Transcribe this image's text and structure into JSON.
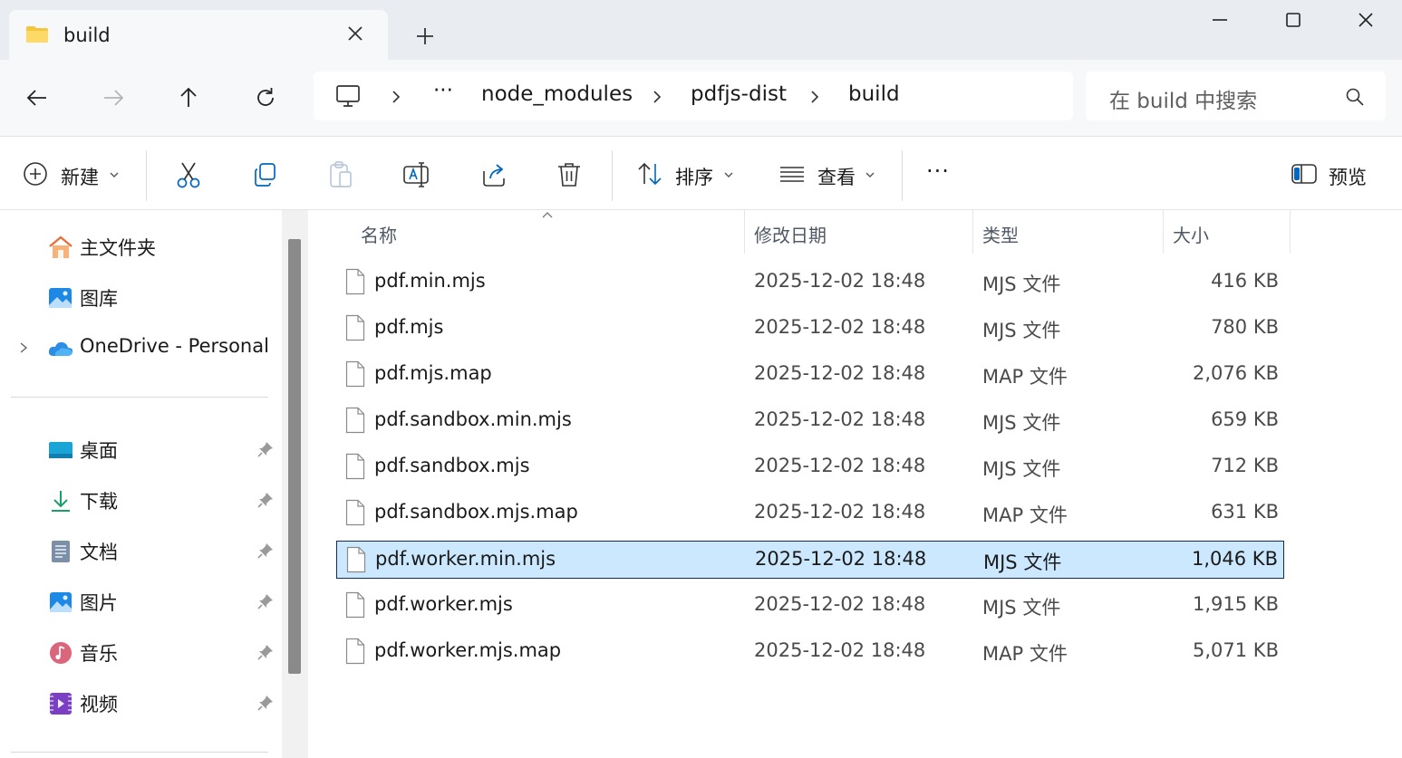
{
  "window": {
    "tab_title": "build",
    "new_tab_icon": "plus-icon",
    "controls": [
      "minimize-icon",
      "maximize-icon",
      "close-icon"
    ]
  },
  "nav": {
    "buttons": [
      "back-arrow-icon",
      "forward-arrow-icon",
      "up-arrow-icon",
      "refresh-icon"
    ],
    "breadcrumb": {
      "overflow": "···",
      "items": [
        "node_modules",
        "pdfjs-dist",
        "build"
      ]
    },
    "search_placeholder": "在 build 中搜索"
  },
  "commands": {
    "new": "新建",
    "sort": "排序",
    "view": "查看",
    "more": "···",
    "preview": "预览"
  },
  "sidebar": {
    "top": [
      {
        "label": "主文件夹",
        "icon": "home-icon"
      },
      {
        "label": "图库",
        "icon": "gallery-icon"
      },
      {
        "label": "OneDrive - Personal",
        "icon": "onedrive-cloud-icon"
      }
    ],
    "pinned": [
      {
        "label": "桌面",
        "icon": "desktop-icon"
      },
      {
        "label": "下载",
        "icon": "download-icon"
      },
      {
        "label": "文档",
        "icon": "documents-icon"
      },
      {
        "label": "图片",
        "icon": "pictures-icon"
      },
      {
        "label": "音乐",
        "icon": "music-icon"
      },
      {
        "label": "视频",
        "icon": "videos-icon"
      }
    ]
  },
  "table": {
    "headers": {
      "name": "名称",
      "date": "修改日期",
      "type": "类型",
      "size": "大小"
    },
    "sort_column": "name",
    "rows": [
      {
        "name": "pdf.min.mjs",
        "date": "2025-12-02 18:48",
        "type": "MJS 文件",
        "size": "416 KB"
      },
      {
        "name": "pdf.mjs",
        "date": "2025-12-02 18:48",
        "type": "MJS 文件",
        "size": "780 KB"
      },
      {
        "name": "pdf.mjs.map",
        "date": "2025-12-02 18:48",
        "type": "MAP 文件",
        "size": "2,076 KB"
      },
      {
        "name": "pdf.sandbox.min.mjs",
        "date": "2025-12-02 18:48",
        "type": "MJS 文件",
        "size": "659 KB"
      },
      {
        "name": "pdf.sandbox.mjs",
        "date": "2025-12-02 18:48",
        "type": "MJS 文件",
        "size": "712 KB"
      },
      {
        "name": "pdf.sandbox.mjs.map",
        "date": "2025-12-02 18:48",
        "type": "MAP 文件",
        "size": "631 KB"
      },
      {
        "name": "pdf.worker.min.mjs",
        "date": "2025-12-02 18:48",
        "type": "MJS 文件",
        "size": "1,046 KB"
      },
      {
        "name": "pdf.worker.mjs",
        "date": "2025-12-02 18:48",
        "type": "MJS 文件",
        "size": "1,915 KB"
      },
      {
        "name": "pdf.worker.mjs.map",
        "date": "2025-12-02 18:48",
        "type": "MAP 文件",
        "size": "5,071 KB"
      }
    ],
    "selected_index": 6
  },
  "colors": {
    "accent": "#0067c0",
    "selection_bg": "#cce8ff",
    "selection_border": "#0f2a5c",
    "titlebar_bg": "#e9ecf1"
  }
}
